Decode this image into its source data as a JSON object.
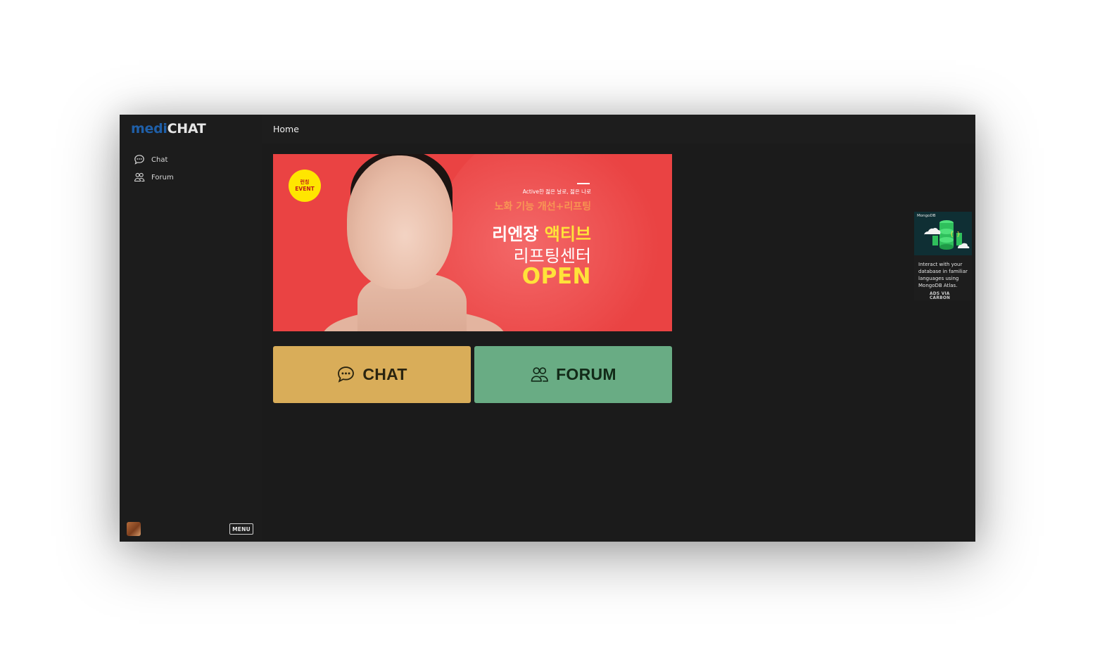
{
  "app": {
    "logo_part1": "medi",
    "logo_part2": "CHAT"
  },
  "sidebar": {
    "items": [
      {
        "label": "Chat",
        "icon": "chat-bubble-icon"
      },
      {
        "label": "Forum",
        "icon": "users-icon"
      }
    ],
    "menu_label": "MENU"
  },
  "header": {
    "title": "Home",
    "icons": [
      "settings-gear-icon",
      "globe-icon"
    ]
  },
  "banner": {
    "badge_line1": "런칭",
    "badge_line2": "EVENT",
    "tagline": "Active한 젊은 날로, 젊은 나로",
    "subtitle": "노화 기능 개선+리프팅",
    "line1_white": "리엔장",
    "line1_yellow": "액티브",
    "line2": "리프팅센터",
    "line3": "OPEN"
  },
  "buttons": {
    "chat_label": "CHAT",
    "forum_label": "FORUM"
  },
  "ad": {
    "brand": "MongoDB",
    "text": "Interact with your database in familiar languages using MongoDB Atlas.",
    "via": "ADS VIA CARBON"
  },
  "colors": {
    "logo_accent": "#1f5fa8",
    "chat_button": "#d9ad59",
    "forum_button": "#69ac84",
    "banner_red": "#ea4343",
    "banner_yellow": "#ffe23a"
  }
}
